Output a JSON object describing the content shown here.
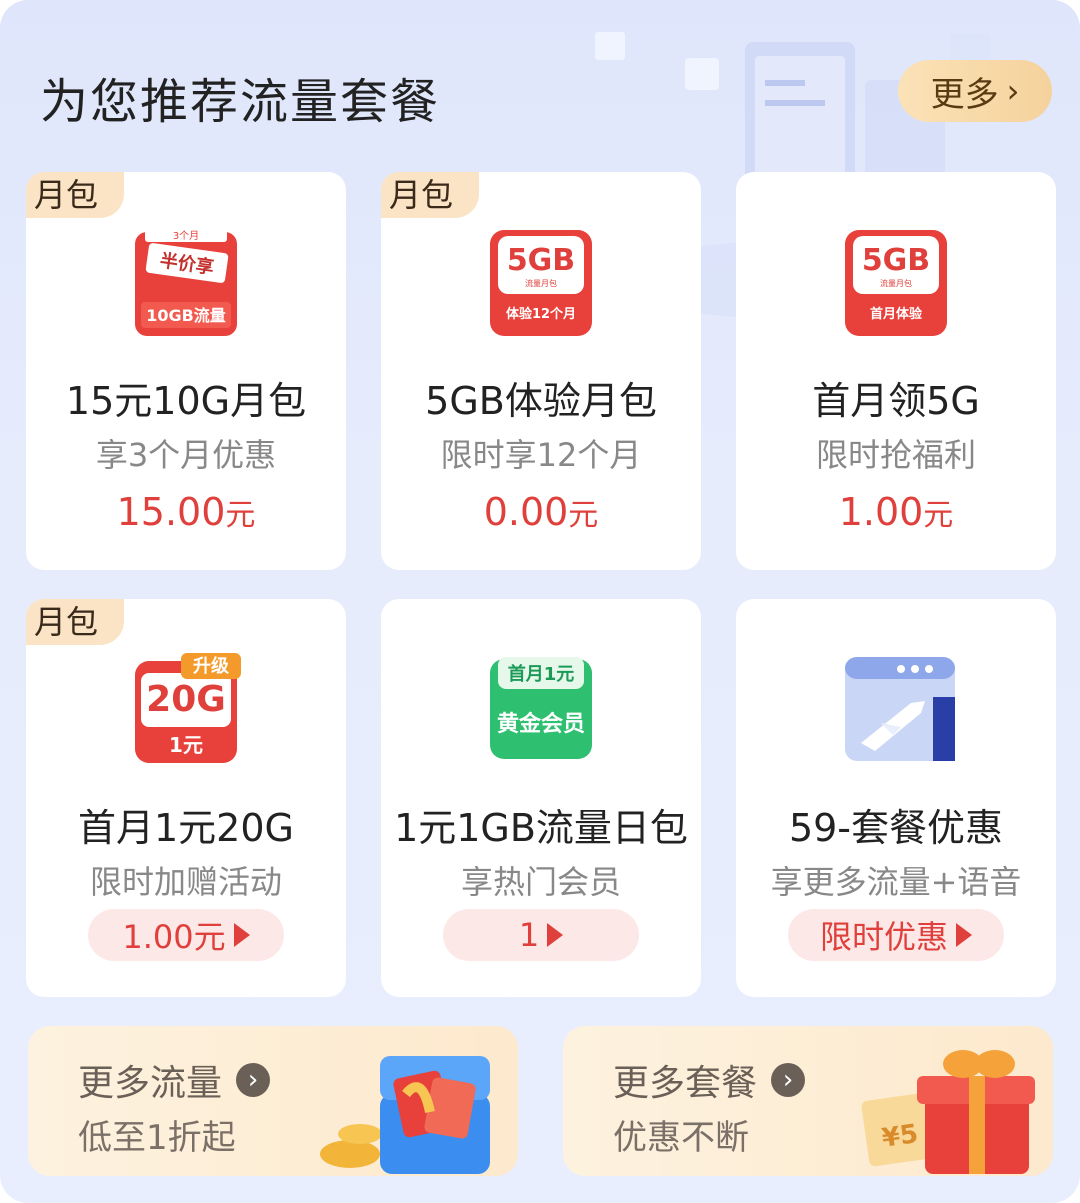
{
  "header": {
    "title": "为您推荐流量套餐",
    "more_label": "更多"
  },
  "cards": [
    {
      "tag": "月包",
      "name": "15元10G月包",
      "sub": "享3个月优惠",
      "price_num": "15.00",
      "price_unit": "元",
      "icon": {
        "top": "3个月",
        "mid": "半价享",
        "bottom": "10GB流量"
      }
    },
    {
      "tag": "月包",
      "name": "5GB体验月包",
      "sub": "限时享12个月",
      "price_num": "0.00",
      "price_unit": "元",
      "icon": {
        "top": "5GB",
        "mid": "流量月包",
        "bottom": "体验12个月"
      }
    },
    {
      "tag": "",
      "name": "首月领5G",
      "sub": "限时抢福利",
      "price_num": "1.00",
      "price_unit": "元",
      "icon": {
        "top": "5GB",
        "mid": "流量月包",
        "bottom": "首月体验"
      }
    },
    {
      "tag": "月包",
      "name": "首月1元20G",
      "sub": "限时加赠活动",
      "pill": "1.00元",
      "icon": {
        "badge": "升级",
        "top": "20G",
        "bottom": "1元"
      }
    },
    {
      "tag": "",
      "name": "1元1GB流量日包",
      "sub": "享热门会员",
      "pill": "1",
      "icon": {
        "top": "首月1元",
        "bottom": "黄金会员"
      }
    },
    {
      "tag": "",
      "name": "59-套餐优惠",
      "sub": "享更多流量+语音",
      "pill": "限时优惠",
      "icon": "airplane-window-icon"
    }
  ],
  "promos": [
    {
      "title": "更多流量",
      "sub": "低至1折起",
      "illus": "red-envelope-box-icon"
    },
    {
      "title": "更多套餐",
      "sub": "优惠不断",
      "illus": "gift-box-icon",
      "coupon": "¥5"
    }
  ],
  "colors": {
    "accent_red": "#e0403b",
    "tag_bg": "#fbe3c5",
    "more_bg": "#f5d29c",
    "panel_bg": "#e4eafc"
  }
}
